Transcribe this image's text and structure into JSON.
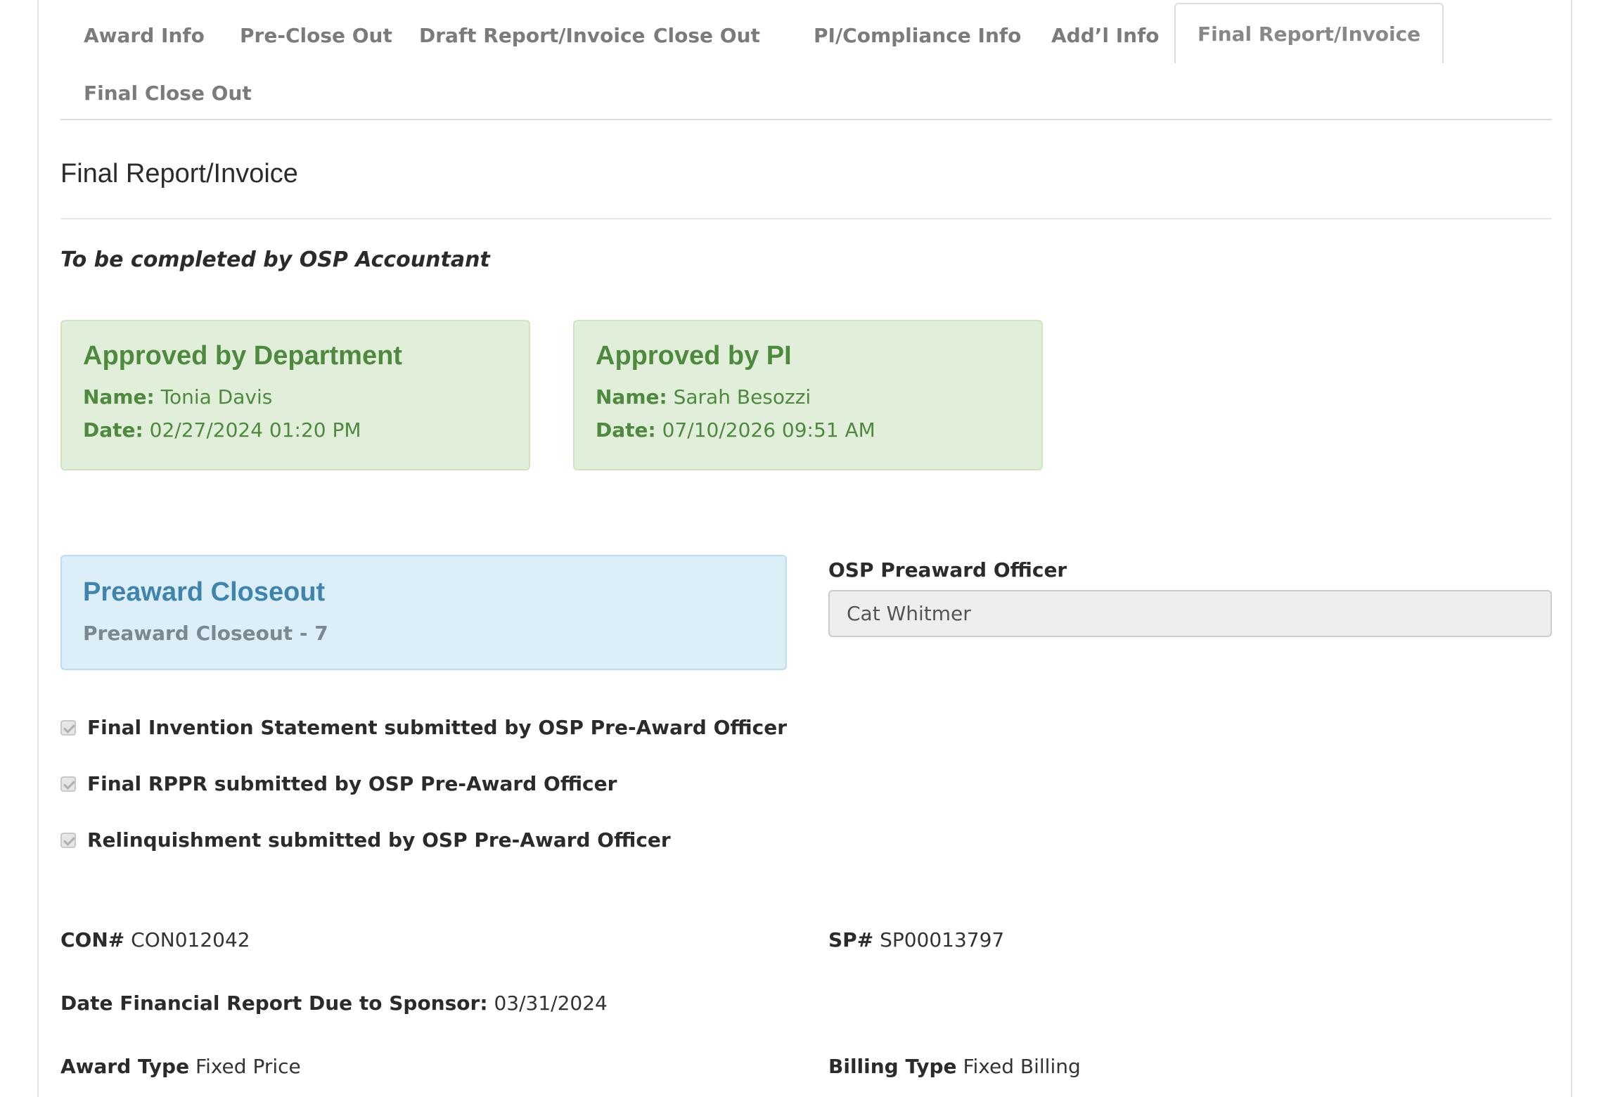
{
  "tabs": [
    {
      "label": "Award Info"
    },
    {
      "label": "Pre-Close Out"
    },
    {
      "label": "Draft Report/Invoice"
    },
    {
      "label": "Close Out"
    },
    {
      "label": "PI/Compliance Info"
    },
    {
      "label": "Add’l Info"
    },
    {
      "label": "Final Report/Invoice"
    },
    {
      "label": "Final Close Out"
    }
  ],
  "section": {
    "title": "Final Report/Invoice",
    "note": "To be completed by OSP Accountant"
  },
  "approvals": {
    "department": {
      "heading": "Approved by Department",
      "name_label": "Name:",
      "name": "Tonia Davis",
      "date_label": "Date:",
      "date": "02/27/2024 01:20 PM"
    },
    "pi": {
      "heading": "Approved by PI",
      "name_label": "Name:",
      "name": "Sarah Besozzi",
      "date_label": "Date:",
      "date": "07/10/2026 09:51 AM"
    }
  },
  "preaward": {
    "heading": "Preaward Closeout",
    "subtitle": "Preaward Closeout - 7",
    "officer_label": "OSP Preaward Officer",
    "officer_value": "Cat Whitmer"
  },
  "checklist": [
    {
      "label": "Final Invention Statement submitted by OSP Pre-Award Officer",
      "checked": true
    },
    {
      "label": "Final RPPR submitted by OSP Pre-Award Officer",
      "checked": true
    },
    {
      "label": "Relinquishment submitted by OSP Pre-Award Officer",
      "checked": true
    }
  ],
  "fields": {
    "con_label": "CON#",
    "con_value": "CON012042",
    "sp_label": "SP#",
    "sp_value": "SP00013797",
    "due_label": "Date Financial Report Due to Sponsor:",
    "due_value": "03/31/2024",
    "award_type_label": "Award Type",
    "award_type_value": "Fixed Price",
    "billing_type_label": "Billing Type",
    "billing_type_value": "Fixed Billing"
  }
}
